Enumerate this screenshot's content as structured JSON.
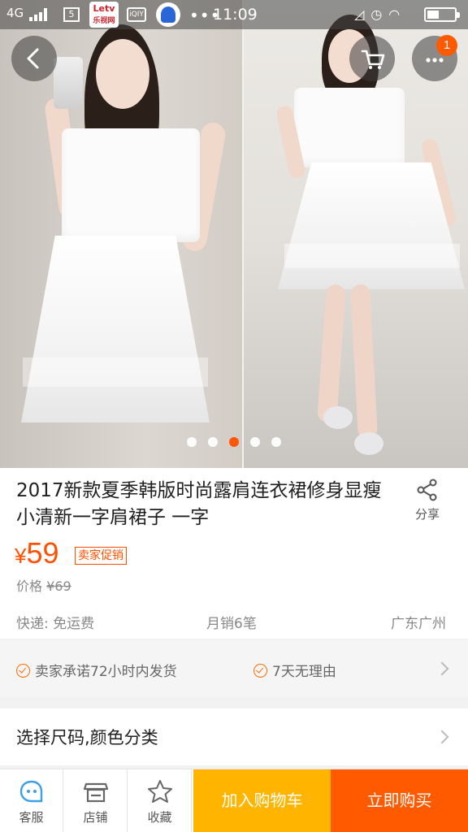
{
  "status_bar": {
    "network": "4G",
    "letv_top": "Letv",
    "letv_bottom": "乐视网",
    "iqiyi": "iQIY",
    "dots": "•••",
    "time": "11:09"
  },
  "header": {
    "cart_badge": "1"
  },
  "gallery": {
    "page_count": 5,
    "active_index": 2
  },
  "product": {
    "title": "2017新款夏季韩版时尚露肩连衣裙修身显瘦小清新一字肩裙子 一字",
    "share_label": "分享",
    "currency": "¥",
    "price": "59",
    "promo_tag": "卖家促销",
    "original_price_label": "价格",
    "original_price": "¥69",
    "shipping": "快递: 免运费",
    "monthly_sales": "月销6笔",
    "location": "广东广州"
  },
  "guarantees": [
    "卖家承诺72小时内发货",
    "7天无理由"
  ],
  "sku": {
    "label": "选择尺码,颜色分类"
  },
  "bottom_bar": {
    "service_label": "客服",
    "shop_label": "店铺",
    "favorite_label": "收藏",
    "add_to_cart": "加入购物车",
    "buy_now": "立即购买"
  },
  "colors": {
    "accent": "#ff5000",
    "add_cart_bg": "#ffb400",
    "buy_now_bg": "#ff5a00"
  },
  "icons": [
    "back-icon",
    "cart-icon",
    "more-icon",
    "share-icon",
    "check-icon",
    "chevron-right-icon",
    "service-icon",
    "shop-icon",
    "star-icon"
  ]
}
